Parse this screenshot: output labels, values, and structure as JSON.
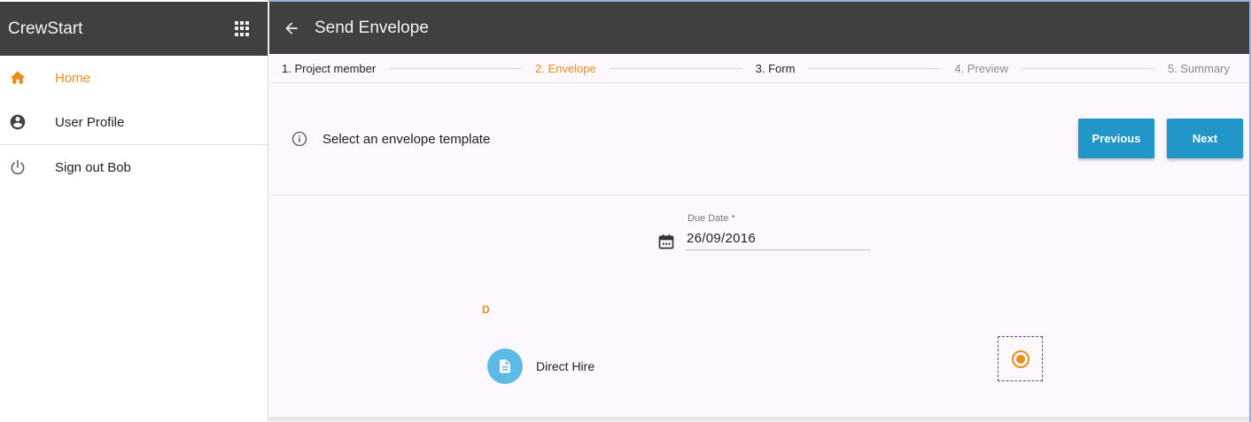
{
  "sidebar": {
    "brand": "CrewStart",
    "apps_icon": "apps-grid-icon",
    "items": [
      {
        "label": "Home",
        "icon": "home-icon",
        "active": true
      },
      {
        "label": "User Profile",
        "icon": "account-circle-icon",
        "active": false
      },
      {
        "label": "Sign out Bob",
        "icon": "power-icon",
        "active": false
      }
    ]
  },
  "header": {
    "back_icon": "arrow-back-icon",
    "title": "Send Envelope"
  },
  "stepper": {
    "steps": [
      {
        "label": "1. Project member",
        "state": "done"
      },
      {
        "label": "2. Envelope",
        "state": "current"
      },
      {
        "label": "3. Form",
        "state": "done"
      },
      {
        "label": "4. Preview",
        "state": "todo"
      },
      {
        "label": "5. Summary",
        "state": "todo"
      }
    ]
  },
  "action_bar": {
    "info_icon": "info-icon",
    "text": "Select an envelope template",
    "previous_label": "Previous",
    "next_label": "Next"
  },
  "form": {
    "due_date_label": "Due Date *",
    "due_date_value": "26/09/2016",
    "calendar_icon": "calendar-icon",
    "group_letter": "D",
    "templates": [
      {
        "name": "Direct Hire",
        "icon": "document-icon",
        "selected": true
      }
    ]
  },
  "colors": {
    "accent": "#f08c1a",
    "primary_button": "#2196c8",
    "app_bar": "#404040",
    "avatar": "#5bbbe6"
  }
}
